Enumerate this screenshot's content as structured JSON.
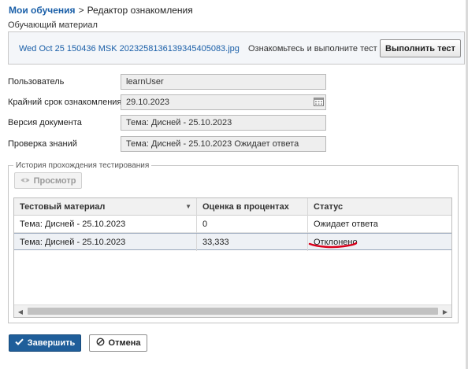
{
  "breadcrumb": {
    "root": "Мои обучения",
    "separator": ">",
    "current": "Редактор ознакомления"
  },
  "material": {
    "section_label": "Обучающий материал",
    "file_link": "Wed Oct 25 150436 MSK 20232581361393454050­83.jpg",
    "hint": "Ознакомьтесь и выполните тест",
    "run_test_button": "Выполнить тест"
  },
  "form": {
    "user_label": "Пользователь",
    "user_value": "learnUser",
    "deadline_label": "Крайний срок ознакомления",
    "deadline_value": "29.10.2023",
    "version_label": "Версия документа",
    "version_value": "Тема: Дисней  - 25.10.2023",
    "check_label": "Проверка знаний",
    "check_value": "Тема: Дисней  - 25.10.2023 Ожидает ответа"
  },
  "history": {
    "legend": "История прохождения тестирования",
    "view_button": "Просмотр",
    "columns": [
      "Тестовый материал",
      "Оценка в процентах",
      "Статус"
    ],
    "rows": [
      [
        "Тема: Дисней - 25.10.2023",
        "0",
        "Ожидает ответа"
      ],
      [
        "Тема: Дисней - 25.10.2023",
        "33,333",
        "Отклонено"
      ]
    ]
  },
  "actions": {
    "finish_button": "Завершить",
    "cancel_button": "Отмена"
  },
  "colors": {
    "link": "#1a5fa8",
    "primary_button": "#1f5e9a",
    "annotation_mark": "#d9001b"
  },
  "icons": {
    "calendar": "calendar-icon",
    "view": "eye-icon",
    "finish": "checkmark-icon",
    "cancel": "cancel-circle-icon",
    "sort": "sort-down-icon"
  }
}
